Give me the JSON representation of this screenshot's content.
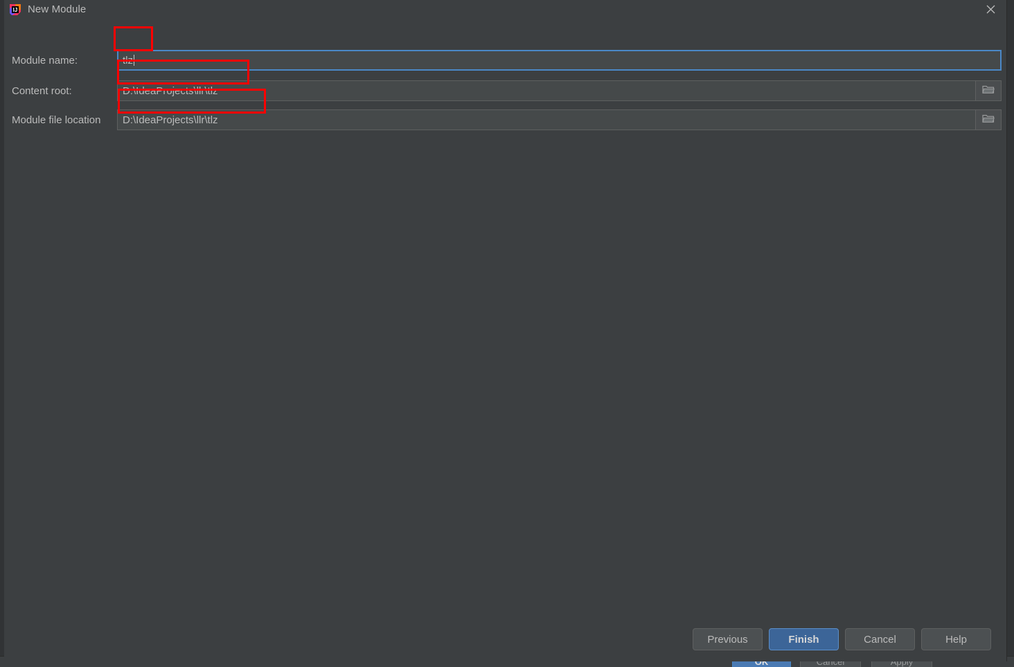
{
  "window": {
    "title": "New Module",
    "app_icon": "intellij-idea-icon",
    "close_icon": "close-icon",
    "bg_color": "#3C3F41",
    "accent_color": "#4A88C7"
  },
  "form": {
    "rows": [
      {
        "label": "Module name:",
        "value": "tlz",
        "placeholder": "",
        "type": "text",
        "focused": true,
        "annotated": true
      },
      {
        "label": "Content root:",
        "value": "D:\\IdeaProjects\\llr\\tlz",
        "placeholder": "",
        "type": "browse",
        "focused": false,
        "annotated": true,
        "browse_icon": "folder-icon"
      },
      {
        "label": "Module file location",
        "value": "D:\\IdeaProjects\\llr\\tlz",
        "placeholder": "",
        "type": "browse",
        "focused": false,
        "annotated": true,
        "browse_icon": "folder-icon"
      }
    ]
  },
  "footer": {
    "buttons": [
      {
        "label": "Previous",
        "primary": false
      },
      {
        "label": "Finish",
        "primary": true
      },
      {
        "label": "Cancel",
        "primary": false
      },
      {
        "label": "Help",
        "primary": false
      }
    ]
  },
  "background_window": {
    "buttons": [
      {
        "label": "OK",
        "primary": true
      },
      {
        "label": "Cancel",
        "primary": false
      },
      {
        "label": "Apply",
        "primary": false
      }
    ]
  },
  "colors": {
    "dialog_background": "#3C3F41",
    "field_background": "#45494A",
    "text": "#BBBBBB",
    "focus_border": "#4A88C7",
    "primary_button": "#3C6598",
    "annotation": "#FF0000"
  }
}
